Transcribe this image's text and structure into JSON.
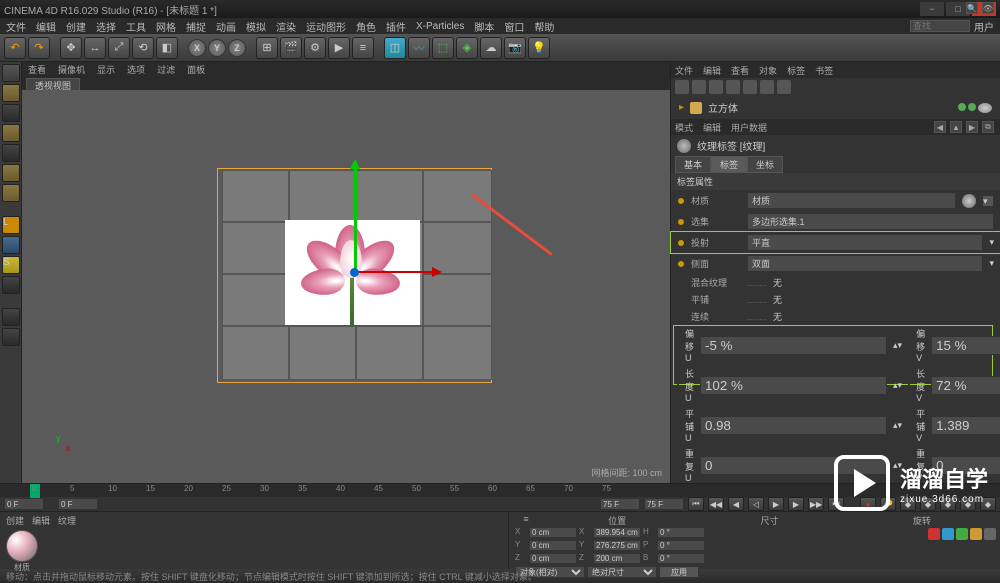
{
  "window": {
    "title": "CINEMA 4D R16.029 Studio (R16) - [未标题 1 *]",
    "min": "−",
    "max": "□",
    "close": "×"
  },
  "menubar": {
    "items": [
      "文件",
      "编辑",
      "创建",
      "选择",
      "工具",
      "网格",
      "捕捉",
      "动画",
      "模拟",
      "渲染",
      "运动图形",
      "角色",
      "插件",
      "X-Particles",
      "脚本",
      "窗口",
      "帮助"
    ],
    "search_placeholder": "查找",
    "search_mode": "用户"
  },
  "toolbar": {
    "undo": "↶",
    "redo": "↷",
    "axis": [
      "X",
      "Y",
      "Z"
    ]
  },
  "center_header": {
    "items": [
      "查看",
      "摄像机",
      "显示",
      "选项",
      "过滤",
      "面板"
    ]
  },
  "viewport_tab": "透视视图",
  "viewport_hud": "网格间距: 100 cm",
  "xyz": {
    "x": "x",
    "y": "y",
    "z": ""
  },
  "objects_panel": {
    "tabs": [
      "文件",
      "编辑",
      "查看",
      "对象",
      "标签",
      "书签"
    ],
    "item": {
      "name": "立方体"
    }
  },
  "attrs_panel": {
    "tabs": [
      "模式",
      "编辑",
      "用户数据"
    ],
    "title": "纹理标签 [纹理]",
    "sub_tabs": [
      "基本",
      "标签",
      "坐标"
    ],
    "section": "标签属性",
    "rows": {
      "material": {
        "label": "材质",
        "value": "材质"
      },
      "selection": {
        "label": "选集",
        "value": "多边形选集.1"
      },
      "projection": {
        "label": "投射",
        "value": "平直"
      },
      "side": {
        "label": "侧面",
        "value": "双面"
      }
    },
    "collapsed": [
      {
        "label": "混合纹理",
        "value": "无"
      },
      {
        "label": "平铺",
        "value": "无"
      },
      {
        "label": "连续",
        "value": "无"
      }
    ],
    "uvw": {
      "r1": [
        {
          "l": "偏移 U",
          "v": "-5 %"
        },
        {
          "l": "偏移 V",
          "v": "15 %"
        }
      ],
      "r2": [
        {
          "l": "长度 U",
          "v": "102 %"
        },
        {
          "l": "长度 V",
          "v": "72 %"
        }
      ],
      "r3": [
        {
          "l": "平铺 U",
          "v": "0.98"
        },
        {
          "l": "平铺 V",
          "v": "1.389"
        }
      ],
      "r4": [
        {
          "l": "重复 U",
          "v": "0"
        },
        {
          "l": "重复 V",
          "v": "0"
        }
      ]
    }
  },
  "timeline": {
    "ticks": [
      "0",
      "5",
      "10",
      "15",
      "20",
      "25",
      "30",
      "35",
      "40",
      "45",
      "50",
      "55",
      "60",
      "65",
      "70",
      "75"
    ],
    "start": "0 F",
    "current": "0 F",
    "end_a": "75 F",
    "end_b": "75 F"
  },
  "materials": {
    "tabs": [
      "创建",
      "编辑",
      "纹理"
    ],
    "name": "材质"
  },
  "coords": {
    "modes": {
      "pos": "位置",
      "size": "尺寸",
      "rot": "旋转"
    },
    "r1": {
      "a": "X",
      "v1": "0 cm",
      "b": "X",
      "v2": "389.954 cm",
      "c": "H",
      "v3": "0 °"
    },
    "r2": {
      "a": "Y",
      "v1": "0 cm",
      "b": "Y",
      "v2": "276.275 cm",
      "c": "P",
      "v3": "0 °"
    },
    "r3": {
      "a": "Z",
      "v1": "0 cm",
      "b": "Z",
      "v2": "200 cm",
      "c": "B",
      "v3": "0 °"
    },
    "mode_label": "对象(相对)",
    "size_label": "绝对尺寸",
    "apply": "应用"
  },
  "logo": {
    "big": "溜溜自学",
    "sub": "zixue.3d66.com"
  },
  "status": "移动：点击并拖动鼠标移动元素。按住 SHIFT 键盘化移动；节点编辑模式时按住 SHIFT 键添加到所选；按住 CTRL 键减小选择对象。"
}
